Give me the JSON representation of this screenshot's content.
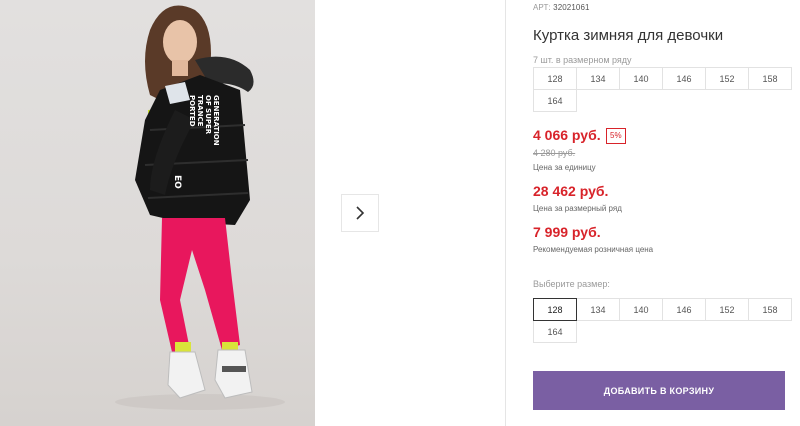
{
  "product": {
    "article_label": "АРТ:",
    "article_number": "32021061",
    "title": "Куртка зимняя для девочки",
    "pack_info": "7 шт. в размерном ряду"
  },
  "size_row": [
    "128",
    "134",
    "140",
    "146",
    "152",
    "158",
    "164"
  ],
  "prices": {
    "unit_price": "4 066 руб.",
    "discount_badge": "5%",
    "old_price": "4 280 руб.",
    "unit_label": "Цена за единицу",
    "range_price": "28 462 руб.",
    "range_label": "Цена за размерный ряд",
    "retail_price": "7 999 руб.",
    "retail_label": "Рекомендуемая розничная цена"
  },
  "size_selector": {
    "label": "Выберите размер:",
    "options": [
      "128",
      "134",
      "140",
      "146",
      "152",
      "158",
      "164"
    ],
    "selected": "128"
  },
  "buttons": {
    "add_to_cart": "ДОБАВИТЬ В КОРЗИНУ",
    "next_icon": "chevron-right-icon"
  },
  "photo": {
    "jacket_print": [
      "GENERATION",
      "OF SUPER",
      "TRANCE",
      "PORTED"
    ],
    "sleeve_print": "EO"
  },
  "colors": {
    "price_red": "#d8232a",
    "button_purple": "#7a5fa3",
    "pants_pink": "#e8175d",
    "jacket_black": "#151515"
  }
}
